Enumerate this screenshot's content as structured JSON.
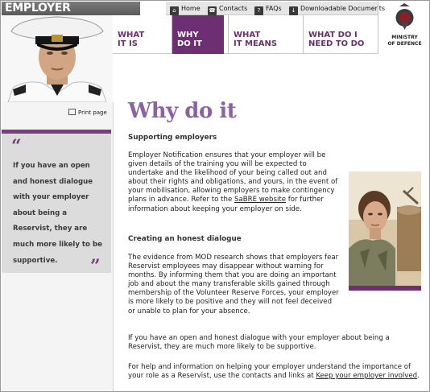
{
  "site": {
    "title": "EMPLOYER NOTIFICATION"
  },
  "top_links": [
    {
      "icon": "home-icon",
      "label": "Home"
    },
    {
      "icon": "contacts-icon",
      "label": "Contacts"
    },
    {
      "icon": "faq-icon",
      "label": "FAQs"
    },
    {
      "icon": "download-icon",
      "label": "Downloadable Documents"
    }
  ],
  "nav": [
    {
      "line1": "WHAT",
      "line2": "IT IS",
      "active": false
    },
    {
      "line1": "WHY",
      "line2": "DO IT",
      "active": true
    },
    {
      "line1": "WHAT",
      "line2": "IT MEANS",
      "active": false
    },
    {
      "line1": "WHAT DO I",
      "line2": "NEED TO DO",
      "active": false
    }
  ],
  "mod": {
    "line1": "MINISTRY",
    "line2": "OF DEFENCE"
  },
  "print_label": "Print page",
  "quote": "If you have an open and honest dialogue with your employer about being a Reservist, they are much more likely to be supportive.",
  "page": {
    "title": "Why do it",
    "section1_heading": "Supporting employers",
    "para1_before": "Employer Notification ensures that your employer will be given details of the training you will be expected to undertake and the likelihood of your being called out and about their rights and obligations, and yours, in the event of your mobilisation, allowing employers to make contingency plans in advance. Refer to the ",
    "para1_link": "SaBRE website",
    "para1_after": " for further information about keeping your employer on side.",
    "section2_heading": "Creating an honest dialogue",
    "para2": "The evidence from MOD research shows that employers fear Reservist employees may disappear without warning for months. By informing them that you are doing an important job and about the many transferable skills gained through membership of the Volunteer Reserve Forces, your employer is more likely to be positive and they will not feel deceived or unable to plan for your absence.",
    "para3": "If you have an open and honest dialogue with your employer about being a Reservist, they are much more likely to be supportive.",
    "para4_before": "For help and information on helping your employer understand the importance of your role as a Reservist, use the contacts and links at ",
    "para4_link": "Keep your employer involved",
    "para4_after": "."
  },
  "colors": {
    "brand_purple": "#6e2f72",
    "heading_purple": "#8b63a0"
  }
}
